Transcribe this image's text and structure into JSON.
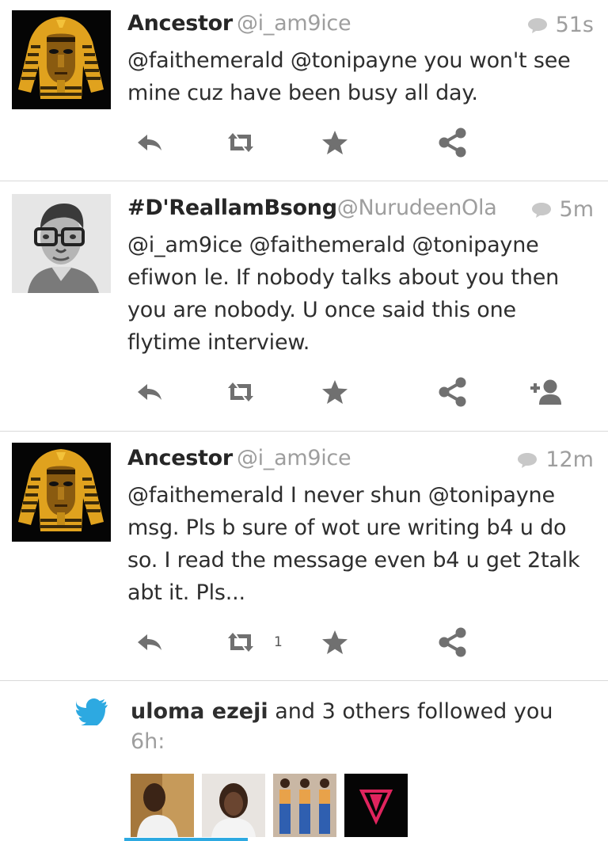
{
  "tweets": [
    {
      "name": "Ancestor",
      "handle": "@i_am9ice",
      "time": "51s",
      "text": "@faithemerald @tonipayne you won't see mine cuz have been busy all day.",
      "avatar": "pharaoh-mask"
    },
    {
      "name": "#D'ReallamBsong",
      "handle": "@NurudeenOla",
      "time": "5m",
      "text": "@i_am9ice @faithemerald @tonipayne efiwon le. If nobody talks about you then you are nobody. U once said this one flytime interview.",
      "avatar": "sketch-portrait"
    },
    {
      "name": "Ancestor",
      "handle": "@i_am9ice",
      "time": "12m",
      "text": "@faithemerald I never shun @tonipayne msg. Pls b sure of wot ure writing b4 u do so. I read the message even b4 u get 2talk abt it. Pls...",
      "retweet_count": "1",
      "avatar": "pharaoh-mask"
    }
  ],
  "notification": {
    "user": "uloma ezeji",
    "rest": " and 3 others followed you",
    "time": "6h:"
  },
  "colors": {
    "accent": "#2da9e1",
    "icon": "#707070",
    "muted": "#9e9e9e"
  },
  "icons": [
    "reply-icon",
    "retweet-icon",
    "favorite-icon",
    "share-icon",
    "follow-icon",
    "conversation-icon",
    "twitter-bird-icon"
  ]
}
